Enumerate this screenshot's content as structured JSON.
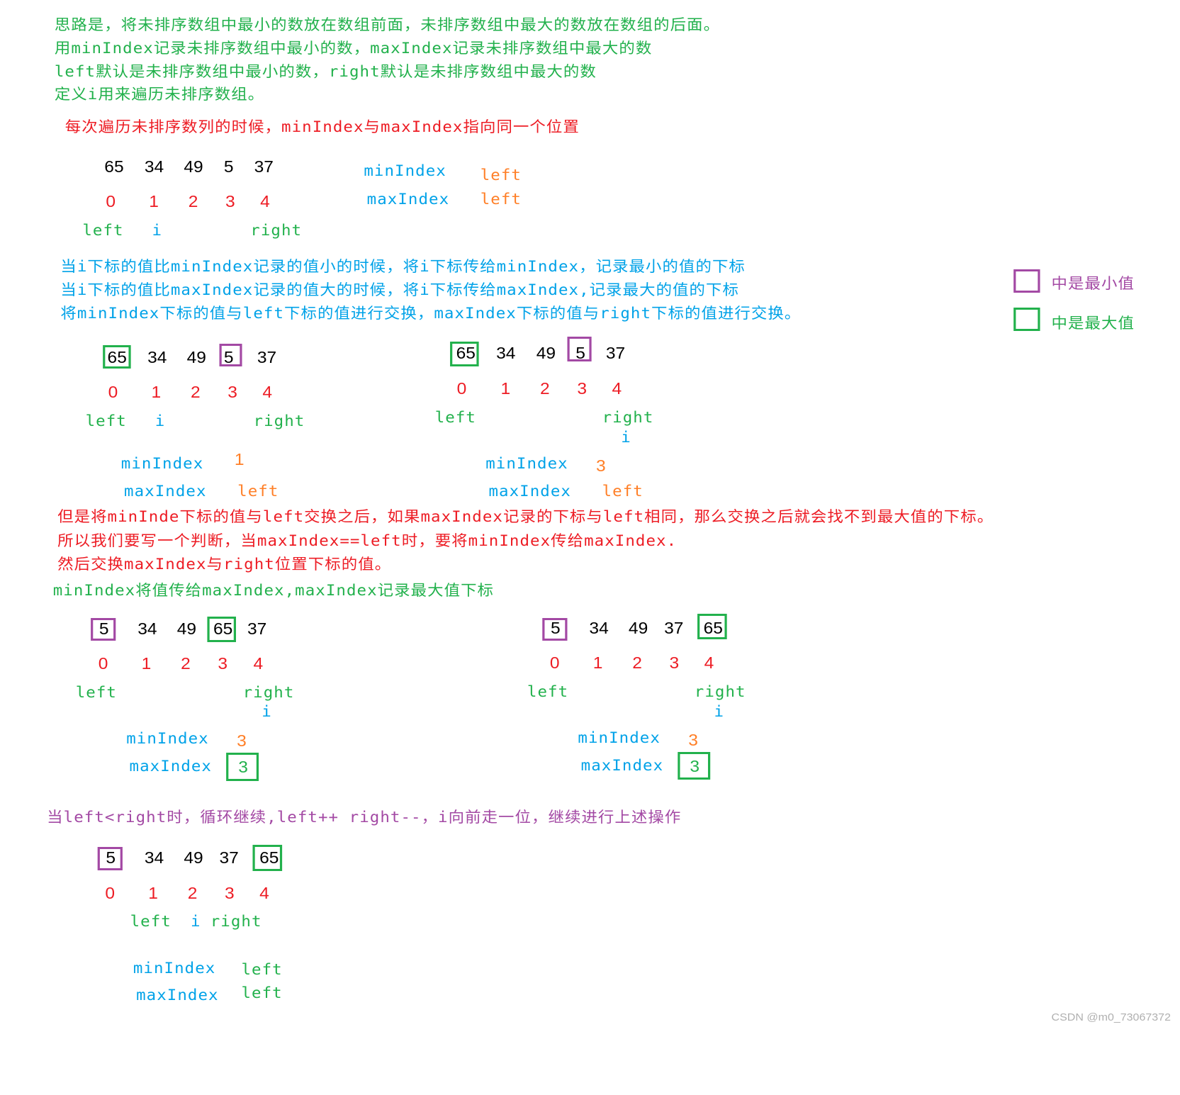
{
  "colors": {
    "green": "#22b14c",
    "red": "#ed1c24",
    "blue": "#00a2e8",
    "orange": "#ff7f27",
    "purple": "#a349a4",
    "black": "#000000"
  },
  "intro": [
    "思路是，将未排序数组中最小的数放在数组前面，未排序数组中最大的数放在数组的后面。",
    "用minIndex记录未排序数组中最小的数，maxIndex记录未排序数组中最大的数",
    "left默认是未排序数组中最小的数，right默认是未排序数组中最大的数",
    "定义i用来遍历未排序数组。"
  ],
  "note_red": "每次遍历未排序数列的时候，minIndex与maxIndex指向同一个位置",
  "explain": [
    "当i下标的值比minIndex记录的值小的时候，将i下标传给minIndex，记录最小的值的下标",
    "当i下标的值比maxIndex记录的值大的时候，将i下标传给maxIndex,记录最大的值的下标",
    "将minIndex下标的值与left下标的值进行交换，maxIndex下标的值与right下标的值进行交换。"
  ],
  "legend": [
    {
      "label": "中是最小值",
      "color": "#a349a4"
    },
    {
      "label": "中是最大值",
      "color": "#22b14c"
    }
  ],
  "red_notes": [
    "但是将minInde下标的值与left交换之后，如果maxIndex记录的下标与left相同，那么交换之后就会找不到最大值的下标。",
    "所以我们要写一个判断，当maxIndex==left时，要将minIndex传给maxIndex.",
    "然后交换maxIndex与right位置下标的值。"
  ],
  "green_note": "minIndex将值传给maxIndex,maxIndex记录最大值下标",
  "purple_note": "当left<right时，循环继续,left++  right--，i向前走一位，继续进行上述操作",
  "labels": {
    "left": "left",
    "i": "i",
    "right": "right",
    "minIndex": "minIndex",
    "maxIndex": "maxIndex"
  },
  "indices": [
    "0",
    "1",
    "2",
    "3",
    "4"
  ],
  "steps": [
    {
      "values": [
        "65",
        "34",
        "49",
        "5",
        "37"
      ],
      "min_value": "left",
      "max_value": "left",
      "min_box": null,
      "max_box": null
    },
    {
      "values": [
        "65",
        "34",
        "49",
        "5",
        "37"
      ],
      "min_value": "1",
      "max_value": "left",
      "min_box": "5",
      "max_box": "65"
    },
    {
      "values": [
        "65",
        "34",
        "49",
        "5",
        "37"
      ],
      "min_value": "3",
      "max_value": "left",
      "min_box": "5",
      "max_box": "65"
    },
    {
      "values": [
        "5",
        "34",
        "49",
        "65",
        "37"
      ],
      "min_value": "3",
      "max_value": "3",
      "min_box": "5",
      "max_box": "65"
    },
    {
      "values": [
        "5",
        "34",
        "49",
        "37",
        "65"
      ],
      "min_value": "3",
      "max_value": "3",
      "min_box": "5",
      "max_box": "65"
    },
    {
      "values": [
        "5",
        "34",
        "49",
        "37",
        "65"
      ],
      "min_value": "left",
      "max_value": "left",
      "min_box": "5",
      "max_box": "65"
    }
  ],
  "watermark": "CSDN @m0_73067372"
}
